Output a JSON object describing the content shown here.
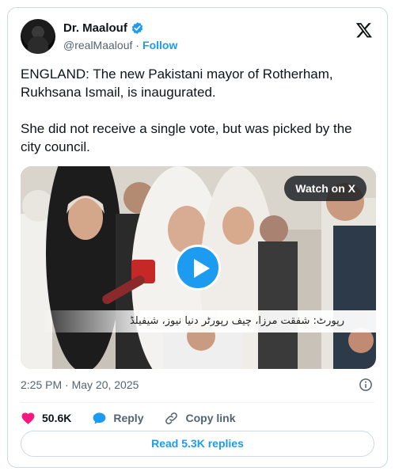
{
  "author": {
    "name": "Dr. Maalouf",
    "handle": "@realMaalouf",
    "separator": "·",
    "follow_label": "Follow"
  },
  "tweet": {
    "text": "ENGLAND: The new Pakistani mayor of Rotherham, Rukhsana Ismail, is inaugurated.\n\nShe did not receive a single vote, but was picked by the city council."
  },
  "media": {
    "watch_label": "Watch on X",
    "caption_text": "رپورٹ: شفقت مرزا، چیف رپورٹر دنیا نیوز، شیفیلڈ"
  },
  "meta": {
    "timestamp": "2:25 PM · May 20, 2025"
  },
  "actions": {
    "likes": "50.6K",
    "reply_label": "Reply",
    "copy_label": "Copy link"
  },
  "footer": {
    "read_replies_label": "Read 5.3K replies"
  },
  "colors": {
    "accent": "#1d9bf0",
    "like": "#f91880",
    "muted": "#536471"
  }
}
